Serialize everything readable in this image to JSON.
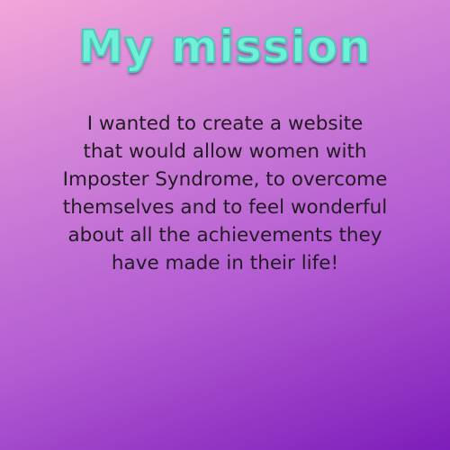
{
  "title": "My mission",
  "body_lines": [
    "I wanted to create a website",
    "that would allow women with",
    "Imposter Syndrome, to overcome",
    "themselves and to feel wonderful",
    "about all the achievements they",
    "have made in their life!"
  ],
  "colors": {
    "title": "#6ff0d9",
    "text": "#231a25",
    "gradient_top": "#f3a6d8",
    "gradient_bottom": "#7e1dba"
  }
}
